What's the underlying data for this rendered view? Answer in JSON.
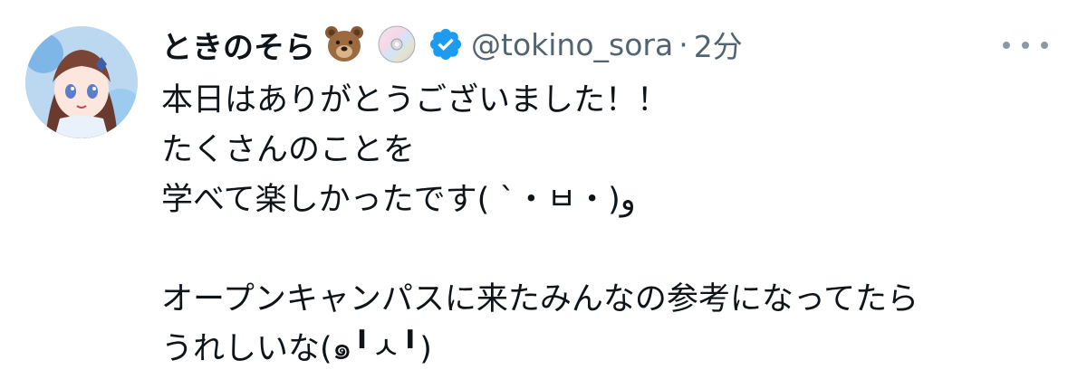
{
  "tweet": {
    "display_name": "ときのそら",
    "badges": [
      "bear-emoji",
      "disc-emoji"
    ],
    "verified": true,
    "handle": "@tokino_sora",
    "separator": "·",
    "time": "2分",
    "lines": [
      "本日はありがとうございました！！",
      "たくさんのことを",
      "学べて楽しかったです( `・ㅂ・)و",
      "",
      "オープンキャンパスに来たみんなの参考になってたら",
      "うれしいな(๑╹ㅅ╹)"
    ]
  },
  "colors": {
    "text": "#0f1419",
    "muted": "#536471",
    "verified": "#1d9bf0"
  },
  "icons": [
    "avatar",
    "bear-emoji",
    "disc-emoji",
    "verified-badge-icon",
    "more-options-icon"
  ]
}
